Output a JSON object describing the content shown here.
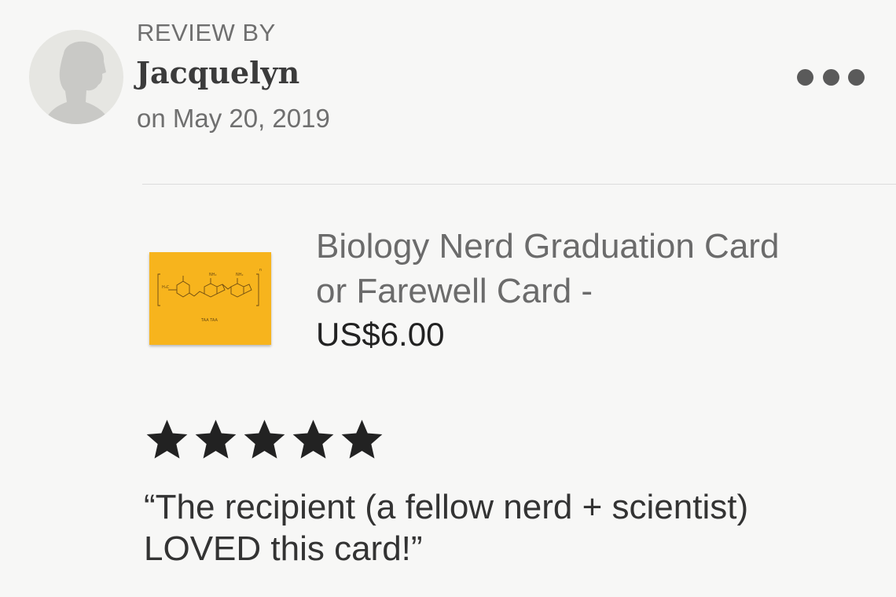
{
  "review": {
    "header_label": "REVIEW BY",
    "reviewer_name": "Jacquelyn",
    "date": "on May 20, 2019",
    "rating": 5,
    "rating_max": 5,
    "text": "“The recipient (a fellow nerd + scientist) LOVED this card!”"
  },
  "product": {
    "title": "Biology Nerd Graduation Card or Farewell Card -",
    "price": "US$6.00",
    "thumbnail_caption": "TAA TAA"
  },
  "icons": {
    "avatar": "default-user-silhouette-icon",
    "more": "more-horizontal-icon",
    "star": "star-filled-icon"
  },
  "colors": {
    "background": "#f7f7f6",
    "card_yellow": "#f7b41d",
    "star": "#222222",
    "muted_text": "#6f6f6f"
  }
}
